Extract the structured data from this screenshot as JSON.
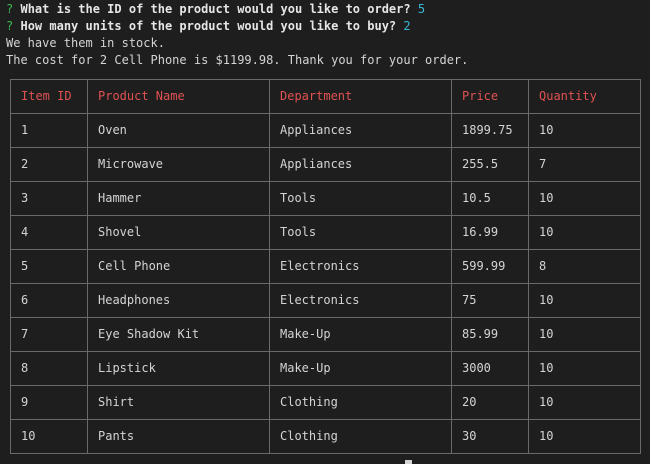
{
  "prompt_1": {
    "mark": "?",
    "question": "What is the ID of the product would you like to order?",
    "answer": "5"
  },
  "prompt_2": {
    "mark": "?",
    "question": "How many units of the product would you like to buy?",
    "answer": "2"
  },
  "stock_message": "We have them in stock.",
  "cost_message": "The cost for 2 Cell Phone is $1199.98. Thank you for your order.",
  "colors": {
    "background": "#1e1e1e",
    "text": "#d4d4d4",
    "header_text": "#e05252",
    "prompt_mark": "#3fb950",
    "answer": "#3ab7d8",
    "border": "#6a6a6a"
  },
  "table": {
    "headers": [
      "Item ID",
      "Product Name",
      "Department",
      "Price",
      "Quantity"
    ],
    "rows": [
      [
        "1",
        "Oven",
        "Appliances",
        "1899.75",
        "10"
      ],
      [
        "2",
        "Microwave",
        "Appliances",
        "255.5",
        "7"
      ],
      [
        "3",
        "Hammer",
        "Tools",
        "10.5",
        "10"
      ],
      [
        "4",
        "Shovel",
        "Tools",
        "16.99",
        "10"
      ],
      [
        "5",
        "Cell Phone",
        "Electronics",
        "599.99",
        "8"
      ],
      [
        "6",
        "Headphones",
        "Electronics",
        "75",
        "10"
      ],
      [
        "7",
        "Eye Shadow Kit",
        "Make-Up",
        "85.99",
        "10"
      ],
      [
        "8",
        "Lipstick",
        "Make-Up",
        "3000",
        "10"
      ],
      [
        "9",
        "Shirt",
        "Clothing",
        "20",
        "10"
      ],
      [
        "10",
        "Pants",
        "Clothing",
        "30",
        "10"
      ]
    ]
  }
}
